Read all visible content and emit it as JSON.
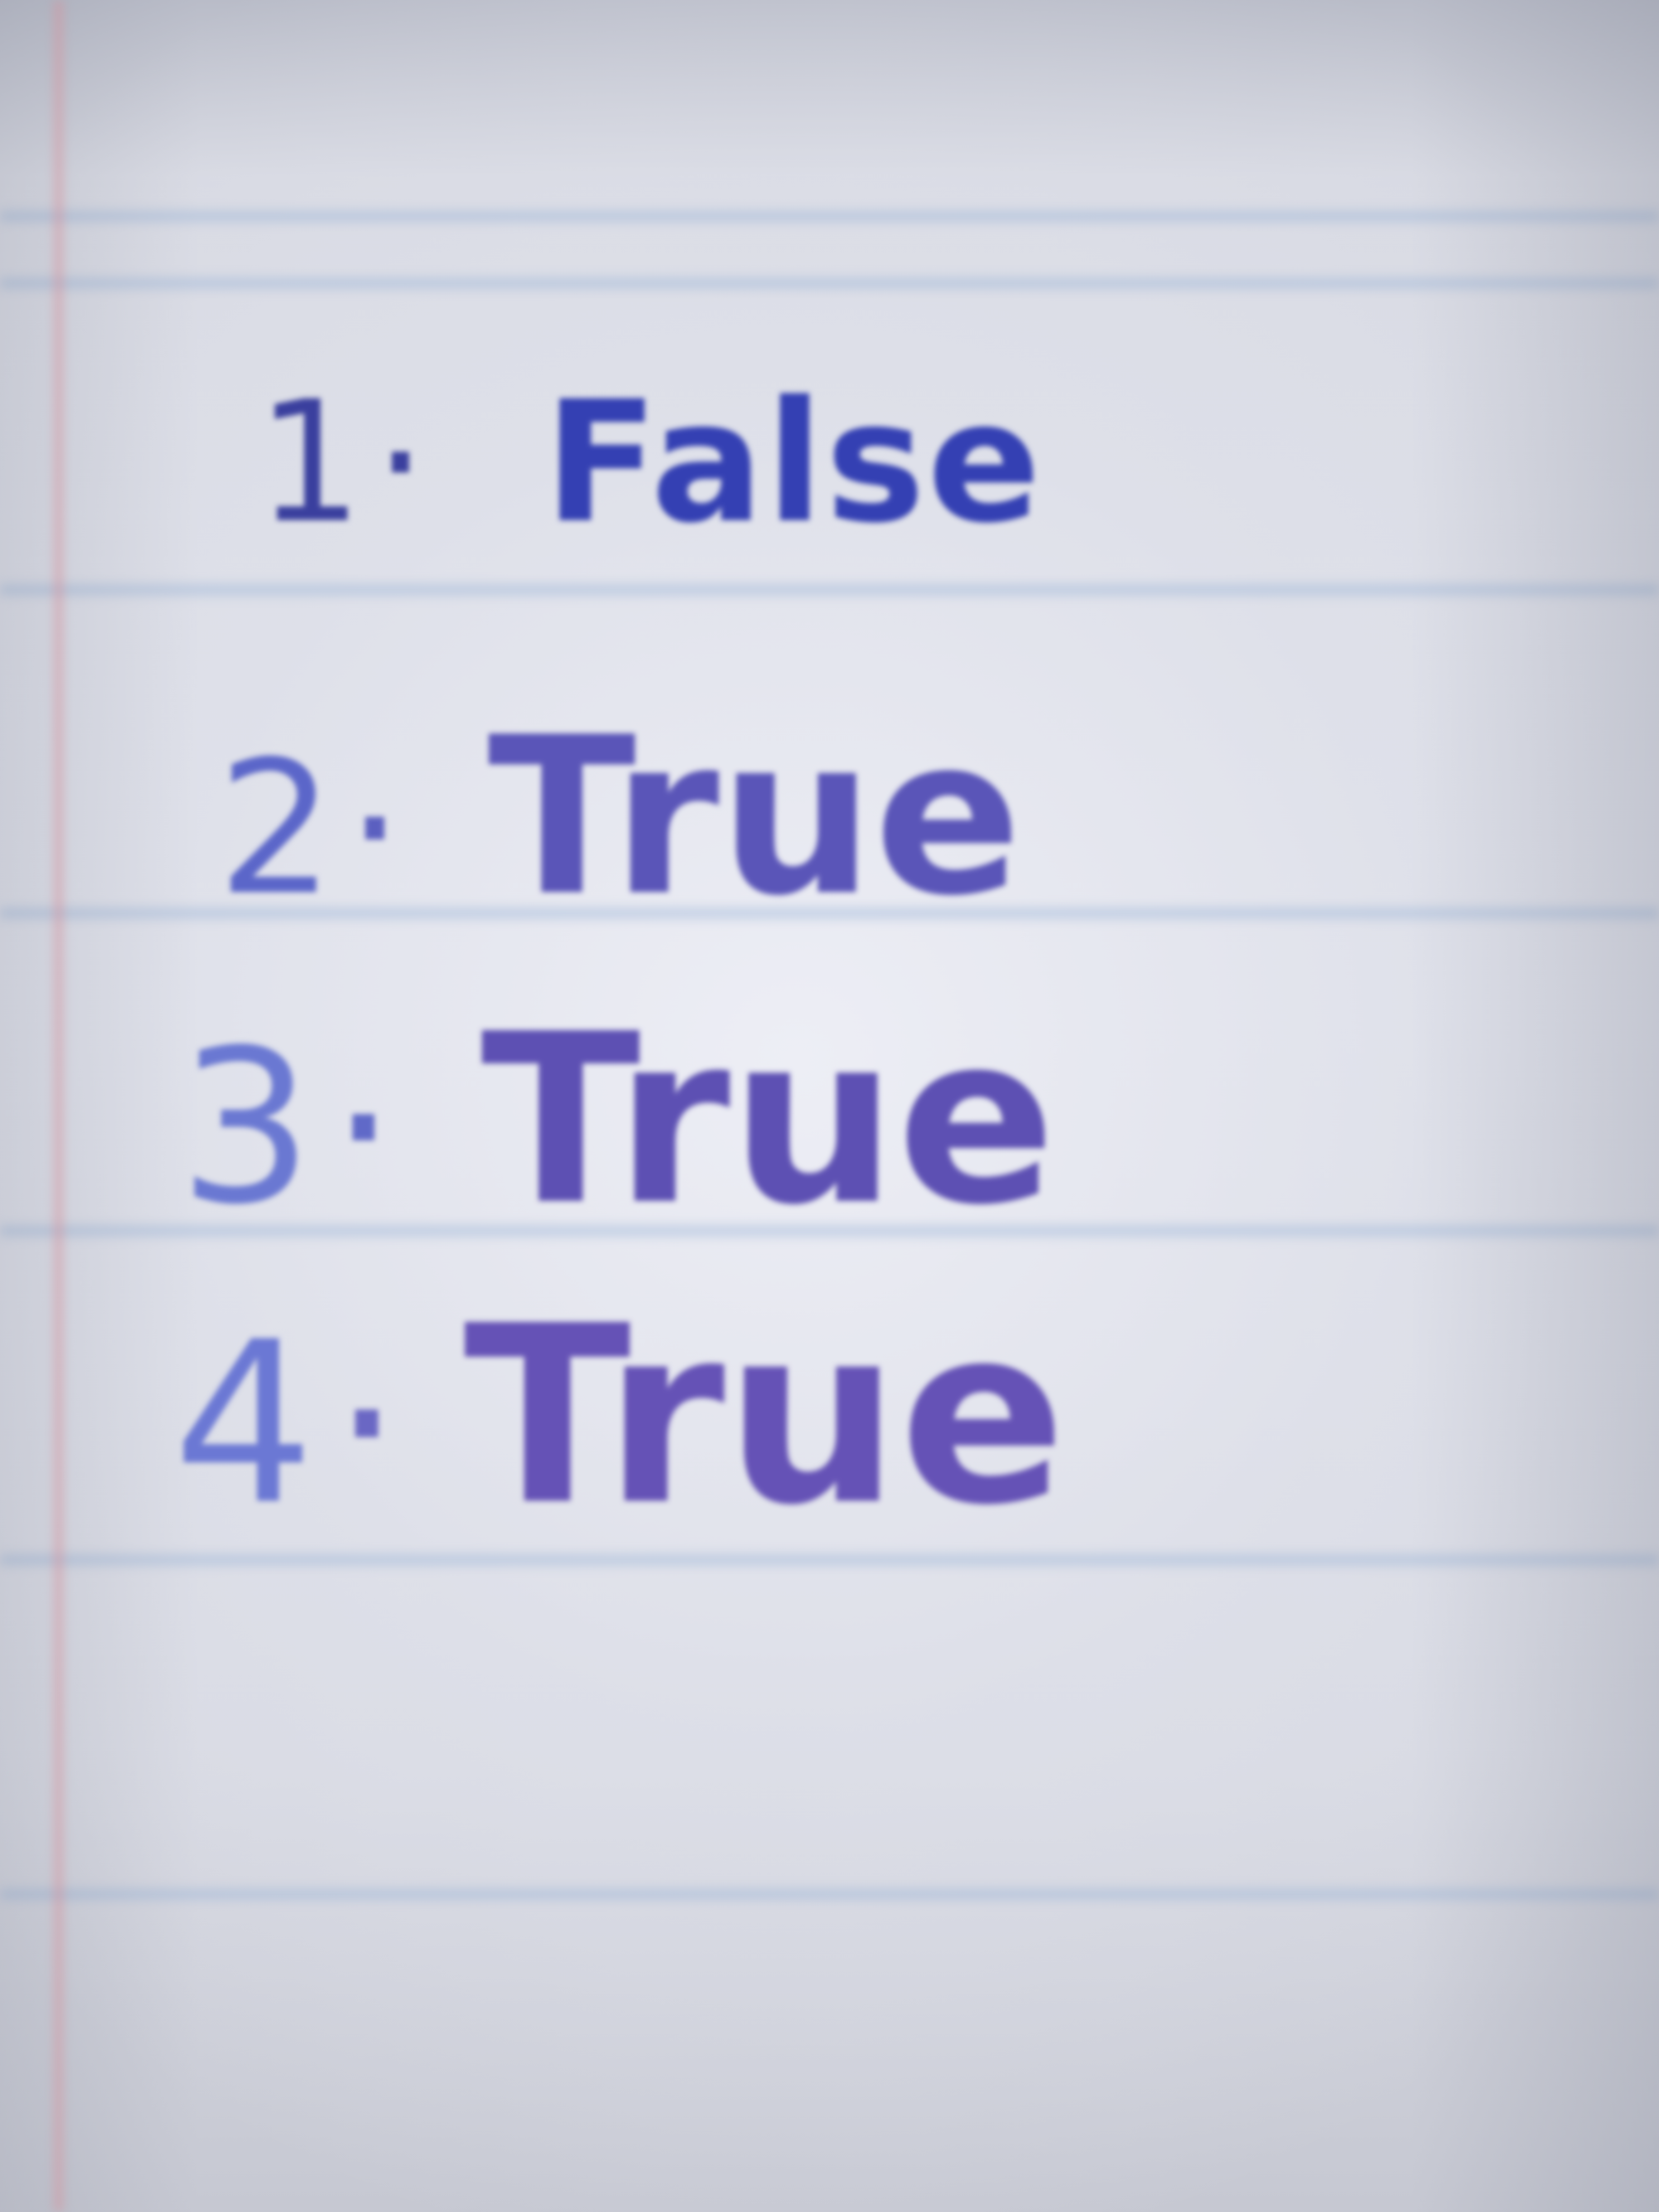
{
  "colors": {
    "paper": "#dcdee7",
    "rule_line": "#96b0d6",
    "margin_line": "#e296a0",
    "ink_dark": "#3440b3",
    "ink_light": "#6552b6"
  },
  "answers": [
    {
      "number": "1",
      "separator": "·",
      "answer": "False"
    },
    {
      "number": "2",
      "separator": "·",
      "answer": "True"
    },
    {
      "number": "3",
      "separator": "·",
      "answer": "True"
    },
    {
      "number": "4",
      "separator": "·",
      "answer": "True"
    }
  ]
}
